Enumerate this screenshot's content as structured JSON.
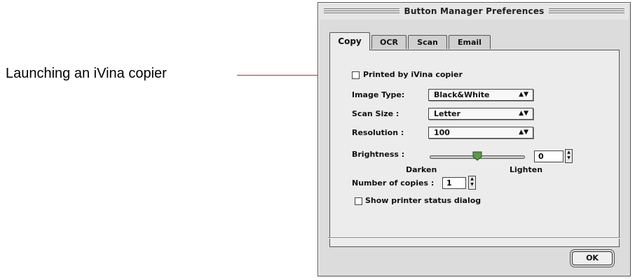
{
  "callout": {
    "text": "Launching an iVina copier"
  },
  "window": {
    "title": "Button Manager Preferences"
  },
  "tabs": [
    {
      "label": "Copy",
      "active": true
    },
    {
      "label": "OCR",
      "active": false
    },
    {
      "label": "Scan",
      "active": false
    },
    {
      "label": "Email",
      "active": false
    }
  ],
  "copy_panel": {
    "printed_by_checkbox": {
      "label": "Printed by iVina copier",
      "checked": false
    },
    "image_type": {
      "label": "Image Type:",
      "value": "Black&White"
    },
    "scan_size": {
      "label": "Scan Size :",
      "value": "Letter"
    },
    "resolution": {
      "label": "Resolution :",
      "value": "100"
    },
    "brightness": {
      "label": "Brightness :",
      "value": "0",
      "min_label": "Darken",
      "max_label": "Lighten",
      "slider_fraction": 0.5
    },
    "copies": {
      "label": "Number of copies :",
      "value": "1"
    },
    "show_status_checkbox": {
      "label": "Show printer status dialog",
      "checked": false
    }
  },
  "footer": {
    "ok_label": "OK"
  },
  "colors": {
    "callout_line": "#b8322a",
    "slider_thumb": "#5a9a45"
  }
}
